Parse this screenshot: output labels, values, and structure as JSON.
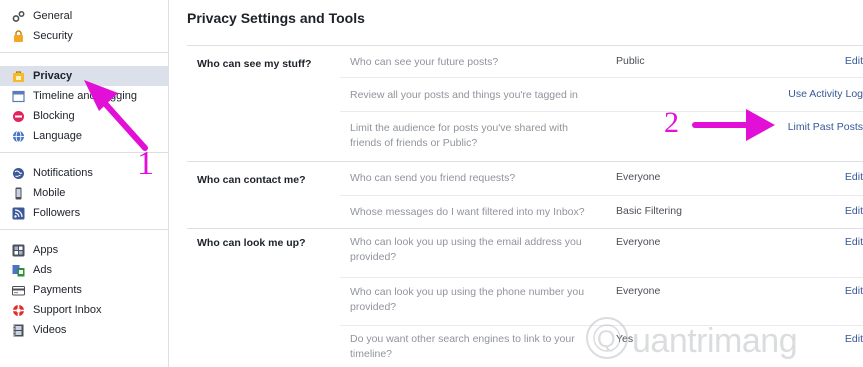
{
  "sidebar": {
    "groups": [
      [
        {
          "label": "General",
          "icon": "gear-icon"
        },
        {
          "label": "Security",
          "icon": "shield-icon"
        }
      ],
      [
        {
          "label": "Privacy",
          "icon": "privacy-lock-icon",
          "active": true
        },
        {
          "label": "Timeline and Tagging",
          "icon": "timeline-icon"
        },
        {
          "label": "Blocking",
          "icon": "block-icon"
        },
        {
          "label": "Language",
          "icon": "globe-icon"
        }
      ],
      [
        {
          "label": "Notifications",
          "icon": "globe-notification-icon"
        },
        {
          "label": "Mobile",
          "icon": "mobile-icon"
        },
        {
          "label": "Followers",
          "icon": "rss-icon"
        }
      ],
      [
        {
          "label": "Apps",
          "icon": "apps-icon"
        },
        {
          "label": "Ads",
          "icon": "ads-icon"
        },
        {
          "label": "Payments",
          "icon": "card-icon"
        },
        {
          "label": "Support Inbox",
          "icon": "lifebuoy-icon"
        },
        {
          "label": "Videos",
          "icon": "film-icon"
        }
      ]
    ]
  },
  "main": {
    "title": "Privacy Settings and Tools",
    "sections": [
      {
        "label": "Who can see my stuff?",
        "rows": [
          {
            "question": "Who can see your future posts?",
            "value": "Public",
            "action": "Edit"
          },
          {
            "question": "Review all your posts and things you're tagged in",
            "value": "",
            "action": "Use Activity Log"
          },
          {
            "question": "Limit the audience for posts you've shared with friends of friends or Public?",
            "value": "",
            "action": "Limit Past Posts"
          }
        ]
      },
      {
        "label": "Who can contact me?",
        "rows": [
          {
            "question": "Who can send you friend requests?",
            "value": "Everyone",
            "action": "Edit"
          },
          {
            "question": "Whose messages do I want filtered into my Inbox?",
            "value": "Basic Filtering",
            "action": "Edit"
          }
        ]
      },
      {
        "label": "Who can look me up?",
        "rows": [
          {
            "question": "Who can look you up using the email address you provided?",
            "value": "Everyone",
            "action": "Edit"
          },
          {
            "question": "Who can look you up using the phone number you provided?",
            "value": "Everyone",
            "action": "Edit"
          },
          {
            "question": "Do you want other search engines to link to your timeline?",
            "value": "Yes",
            "action": "Edit"
          }
        ]
      }
    ]
  },
  "annotations": {
    "label_1": "1",
    "label_2": "2",
    "color": "#e20fd6"
  },
  "watermark": {
    "text": "uantrimang",
    "mark": "Q"
  }
}
